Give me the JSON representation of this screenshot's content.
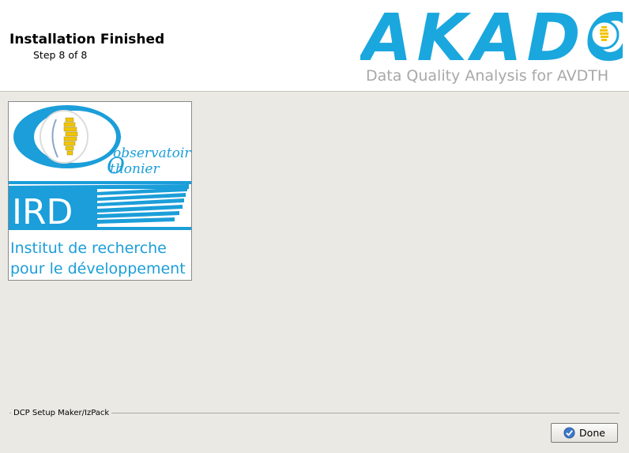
{
  "header": {
    "title": "Installation Finished",
    "step": "Step 8 of 8"
  },
  "brand": {
    "logo_text": "AKADO",
    "tagline": "Data Quality Analysis for AVDTH",
    "logo_color": "#1aa7de",
    "tagline_color": "#a8a8a8"
  },
  "ird_logo": {
    "line1": "Institut de recherche",
    "line2": "pour le développement",
    "ot_top": "observatoire",
    "ot_bottom": "thonier",
    "acronym": "IRD",
    "color": "#1b9ed9"
  },
  "footer": {
    "label": "DCP Setup Maker/IzPack",
    "done_label": "Done",
    "done_icon": "check-circle-icon"
  }
}
